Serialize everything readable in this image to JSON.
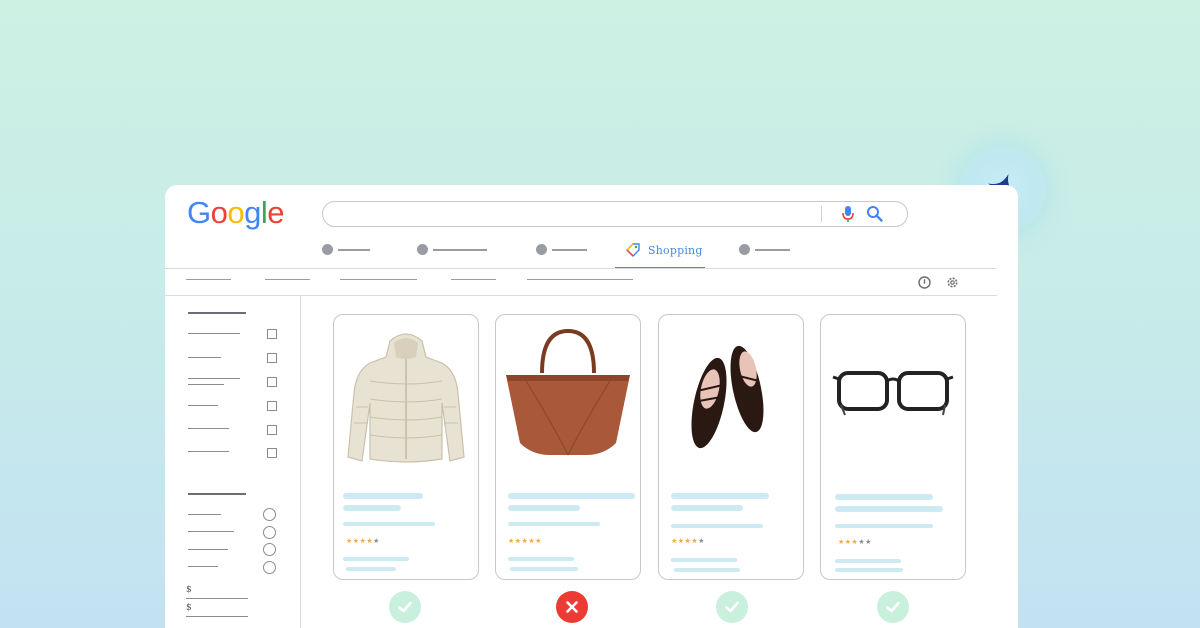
{
  "brand": {
    "logo_letters": [
      {
        "char": "G",
        "color": "#4285F4"
      },
      {
        "char": "o",
        "color": "#EA4335"
      },
      {
        "char": "o",
        "color": "#FBBC05"
      },
      {
        "char": "g",
        "color": "#4285F4"
      },
      {
        "char": "l",
        "color": "#34A853"
      },
      {
        "char": "e",
        "color": "#EA4335"
      }
    ]
  },
  "search": {
    "value": "",
    "icons": [
      "mic-icon",
      "search-icon"
    ]
  },
  "tabs": {
    "active_label": "Shopping",
    "active_color": "#4a86d8",
    "active_icon": "price-tag-icon"
  },
  "toolbar": {
    "icons": [
      "help-icon",
      "gear-icon"
    ]
  },
  "sidebar": {
    "price_symbols": [
      "$",
      "$"
    ],
    "checkbox_count": 6,
    "radio_count": 4
  },
  "products": [
    {
      "image": "puffer-jacket",
      "rating": 4,
      "status": "approved"
    },
    {
      "image": "brown-tote-bag",
      "rating": 5,
      "status": "rejected"
    },
    {
      "image": "black-ballet-flats",
      "rating": 4,
      "status": "approved"
    },
    {
      "image": "eyeglasses",
      "rating": 3,
      "status": "approved"
    }
  ],
  "colors": {
    "approved": "#c9f0dd",
    "rejected": "#ec3b34",
    "star": "#f3a93d",
    "placeholder_line": "#cdeaf3",
    "accent": "#4a86d8",
    "sparkle": "#1f3d8a"
  }
}
